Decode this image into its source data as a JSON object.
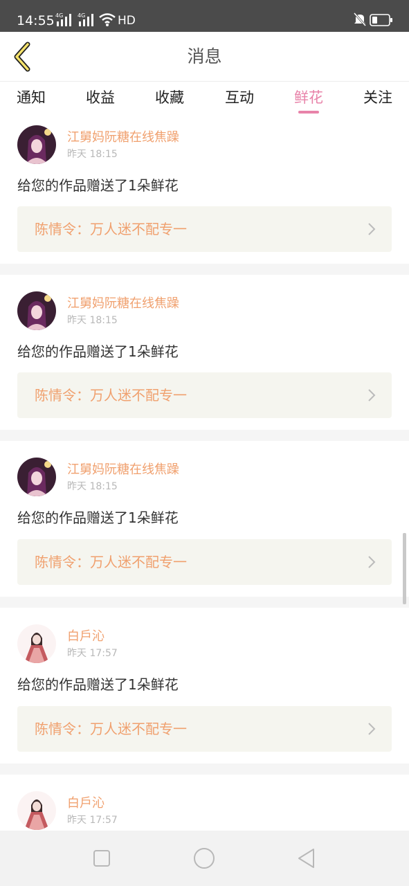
{
  "status_bar": {
    "time": "14:55",
    "network_1": "4G",
    "network_2": "4G",
    "hd": "HD",
    "icons": [
      "signal-icon",
      "signal-icon",
      "wifi-icon",
      "mute-icon",
      "battery-icon"
    ]
  },
  "header": {
    "title": "消息",
    "back_icon": "chevron-left-icon"
  },
  "tabs": [
    {
      "label": "通知",
      "active": false
    },
    {
      "label": "收益",
      "active": false
    },
    {
      "label": "收藏",
      "active": false
    },
    {
      "label": "互动",
      "active": false
    },
    {
      "label": "鲜花",
      "active": true
    },
    {
      "label": "关注",
      "active": false
    }
  ],
  "messages": [
    {
      "user": "江舅妈阮糖在线焦躁",
      "time": "昨天 18:15",
      "text": "给您的作品赠送了1朵鲜花",
      "work": "陈情令：万人迷不配专一"
    },
    {
      "user": "江舅妈阮糖在线焦躁",
      "time": "昨天 18:15",
      "text": "给您的作品赠送了1朵鲜花",
      "work": "陈情令：万人迷不配专一"
    },
    {
      "user": "江舅妈阮糖在线焦躁",
      "time": "昨天 18:15",
      "text": "给您的作品赠送了1朵鲜花",
      "work": "陈情令：万人迷不配专一"
    },
    {
      "user": "白戶沁",
      "time": "昨天 17:57",
      "text": "给您的作品赠送了1朵鲜花",
      "work": "陈情令：万人迷不配专一"
    },
    {
      "user": "白戶沁",
      "time": "昨天 17:57"
    }
  ],
  "colors": {
    "accent_pink": "#e883a9",
    "username_orange": "#f0a06e",
    "work_bg": "#f5f5ef",
    "status_bar_bg": "#4b4b4b"
  },
  "nav_bar": [
    "square-recent-icon",
    "circle-home-icon",
    "triangle-back-icon"
  ]
}
